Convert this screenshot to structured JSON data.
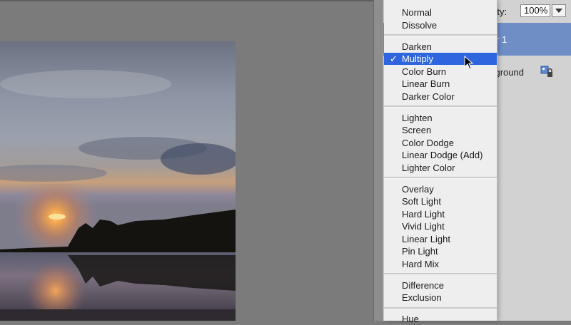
{
  "opacity": {
    "label": "city:",
    "value": "100%"
  },
  "layers": [
    {
      "name": "r 1",
      "selected": true
    },
    {
      "name": "kground",
      "selected": false
    }
  ],
  "blend_menu": {
    "groups": [
      [
        "Normal",
        "Dissolve"
      ],
      [
        "Darken",
        "Multiply",
        "Color Burn",
        "Linear Burn",
        "Darker Color"
      ],
      [
        "Lighten",
        "Screen",
        "Color Dodge",
        "Linear Dodge (Add)",
        "Lighter Color"
      ],
      [
        "Overlay",
        "Soft Light",
        "Hard Light",
        "Vivid Light",
        "Linear Light",
        "Pin Light",
        "Hard Mix"
      ],
      [
        "Difference",
        "Exclusion"
      ],
      [
        "Hue"
      ]
    ],
    "selected": "Multiply",
    "checkmark": "✓"
  },
  "icons": {
    "dropdown": "triangle-down-icon",
    "lock": "lock-icon",
    "cursor": "arrow-cursor-icon"
  },
  "colors": {
    "highlight": "#2f66e0",
    "selected_layer": "#6f8ec6"
  }
}
